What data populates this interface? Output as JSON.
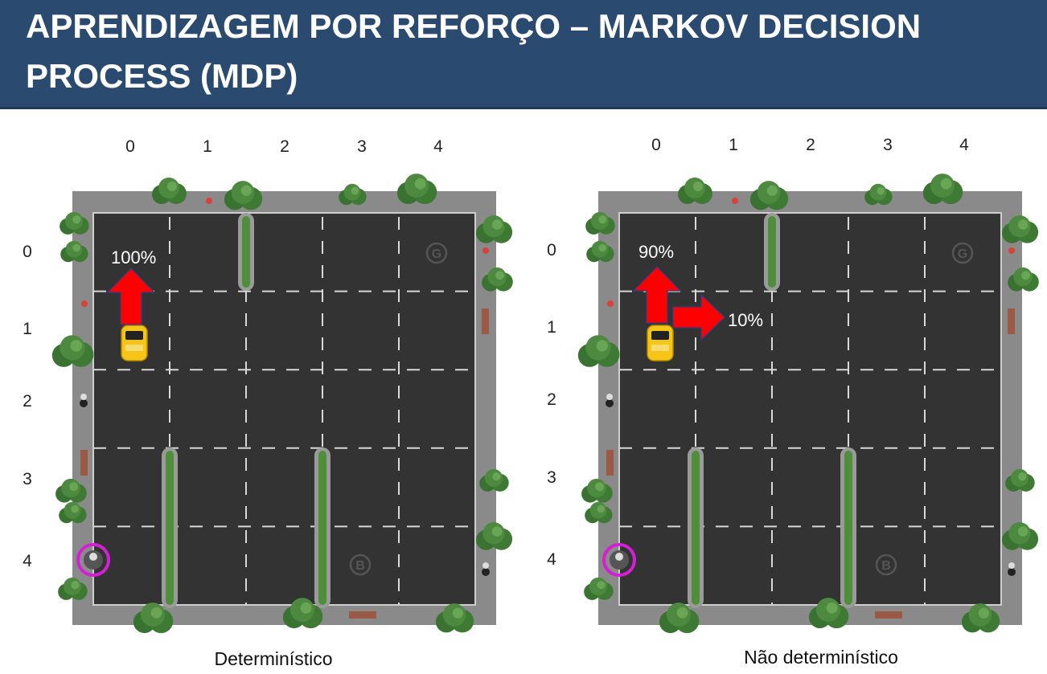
{
  "title": "APRENDIZAGEM POR REFORÇO – MARKOV DECISION PROCESS (MDP)",
  "grid": {
    "columns": [
      "0",
      "1",
      "2",
      "3",
      "4"
    ],
    "rows": [
      "0",
      "1",
      "2",
      "3",
      "4"
    ],
    "landmarks": [
      "G",
      "B"
    ]
  },
  "panels": [
    {
      "caption": "Determinístico",
      "probabilities": {
        "up": "100%"
      }
    },
    {
      "caption": "Não determinístico",
      "probabilities": {
        "up": "90%",
        "right": "10%"
      }
    }
  ],
  "colors": {
    "header": "#2a4a70",
    "road": "#333333",
    "border": "#8a8a8a",
    "arrow": "#ff0000",
    "taxi": "#f5c518",
    "passenger_ring": "#d41fd4",
    "tree": "#3f7a35"
  }
}
